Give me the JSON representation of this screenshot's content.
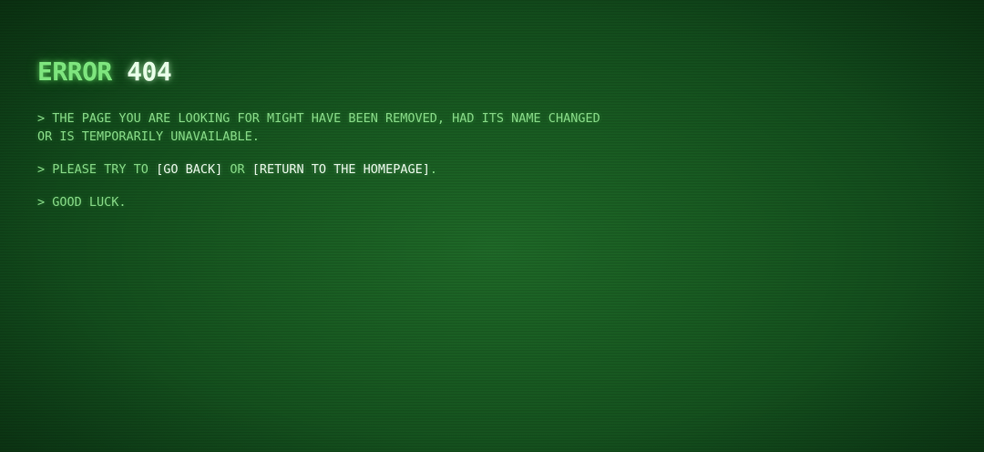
{
  "error": {
    "word": "ERROR",
    "code": "404"
  },
  "messages": {
    "line1": "> THE PAGE YOU ARE LOOKING FOR MIGHT HAVE BEEN REMOVED, HAD ITS NAME CHANGED OR IS TEMPORARILY UNAVAILABLE.",
    "line2_prefix": "> PLEASE TRY TO",
    "go_back": "[GO BACK]",
    "line2_or": "OR",
    "return_home": "[RETURN TO THE HOMEPAGE]",
    "line2_suffix": ".",
    "line3": "> GOOD LUCK."
  },
  "colors": {
    "background": "#185a21",
    "text_green": "#86d886",
    "text_highlight": "#e6f5e6"
  }
}
